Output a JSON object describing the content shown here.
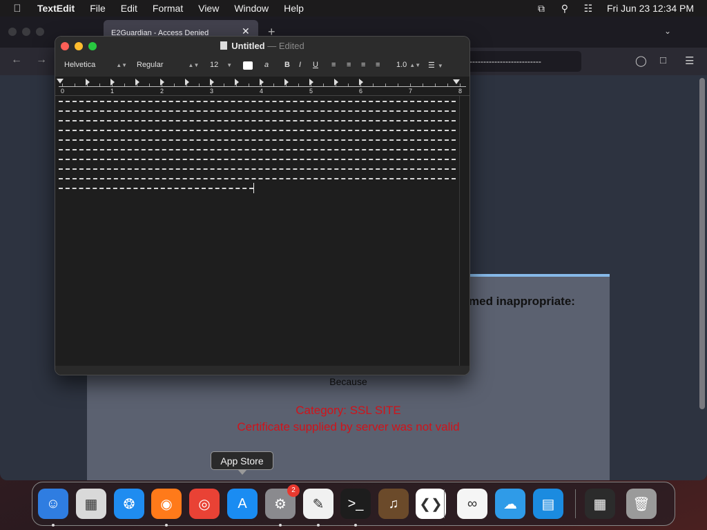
{
  "menubar": {
    "apple_icon": "apple-icon",
    "app_name": "TextEdit",
    "menus": [
      "File",
      "Edit",
      "Format",
      "View",
      "Window",
      "Help"
    ],
    "status_icons": [
      "screen-mirroring-icon",
      "search-icon",
      "control-center-icon"
    ],
    "clock": "Fri Jun 23  12:34 PM"
  },
  "browser": {
    "tab_title": "E2Guardian - Access Denied",
    "url_text": "--------------------------",
    "page": {
      "heading": "med inappropriate:",
      "because": "Because",
      "category": "Category: SSL SITE",
      "reason": "Certificate supplied by server was not valid"
    }
  },
  "textedit": {
    "title": "Untitled",
    "separator": "—",
    "status": "Edited",
    "font_family": "Helvetica",
    "font_style": "Regular",
    "font_size": "12",
    "line_spacing": "1.0",
    "bold": "B",
    "italic": "I",
    "underline": "U",
    "text_color_glyph": "a",
    "ruler_numbers": [
      "0",
      "1",
      "2",
      "3",
      "4",
      "5",
      "6",
      "7",
      "8"
    ],
    "text_line_count": 10
  },
  "tooltip": {
    "label": "App Store"
  },
  "dock": {
    "items": [
      {
        "name": "finder",
        "icon": "finder-icon",
        "color": "#2f7de1",
        "running": true
      },
      {
        "name": "launchpad",
        "icon": "launchpad-icon",
        "color": "#d9d9d9",
        "running": false
      },
      {
        "name": "safari",
        "icon": "safari-icon",
        "color": "#1f8cf0",
        "running": false
      },
      {
        "name": "firefox",
        "icon": "firefox-icon",
        "color": "#ff7a1a",
        "running": true
      },
      {
        "name": "chrome",
        "icon": "chrome-icon",
        "color": "#e94235",
        "running": false
      },
      {
        "name": "app-store",
        "icon": "app-store-icon",
        "color": "#1a8cf2",
        "running": false
      },
      {
        "name": "system-settings",
        "icon": "gear-icon",
        "color": "#8a8a8e",
        "running": true,
        "badge": "2"
      },
      {
        "name": "textedit",
        "icon": "textedit-icon",
        "color": "#f1f1f1",
        "running": true
      },
      {
        "name": "terminal",
        "icon": "terminal-icon",
        "color": "#1d1d1d",
        "running": true
      },
      {
        "name": "garageband",
        "icon": "guitar-icon",
        "color": "#6b4a2a",
        "running": false
      },
      {
        "name": "vscode",
        "icon": "vscode-icon",
        "color": "#ffffff",
        "running": false
      },
      {
        "name": "visual-studio",
        "icon": "visual-studio-icon",
        "color": "#f5f5f5",
        "running": false
      },
      {
        "name": "weather",
        "icon": "weather-icon",
        "color": "#2f9be8",
        "running": false
      },
      {
        "name": "keynote",
        "icon": "keynote-icon",
        "color": "#1b8be0",
        "running": false
      },
      {
        "name": "recent-window",
        "icon": "window-thumbnail-icon",
        "color": "#2b2b2b",
        "running": false
      },
      {
        "name": "trash",
        "icon": "trash-icon",
        "color": "#9a9a9a",
        "running": false
      }
    ]
  }
}
